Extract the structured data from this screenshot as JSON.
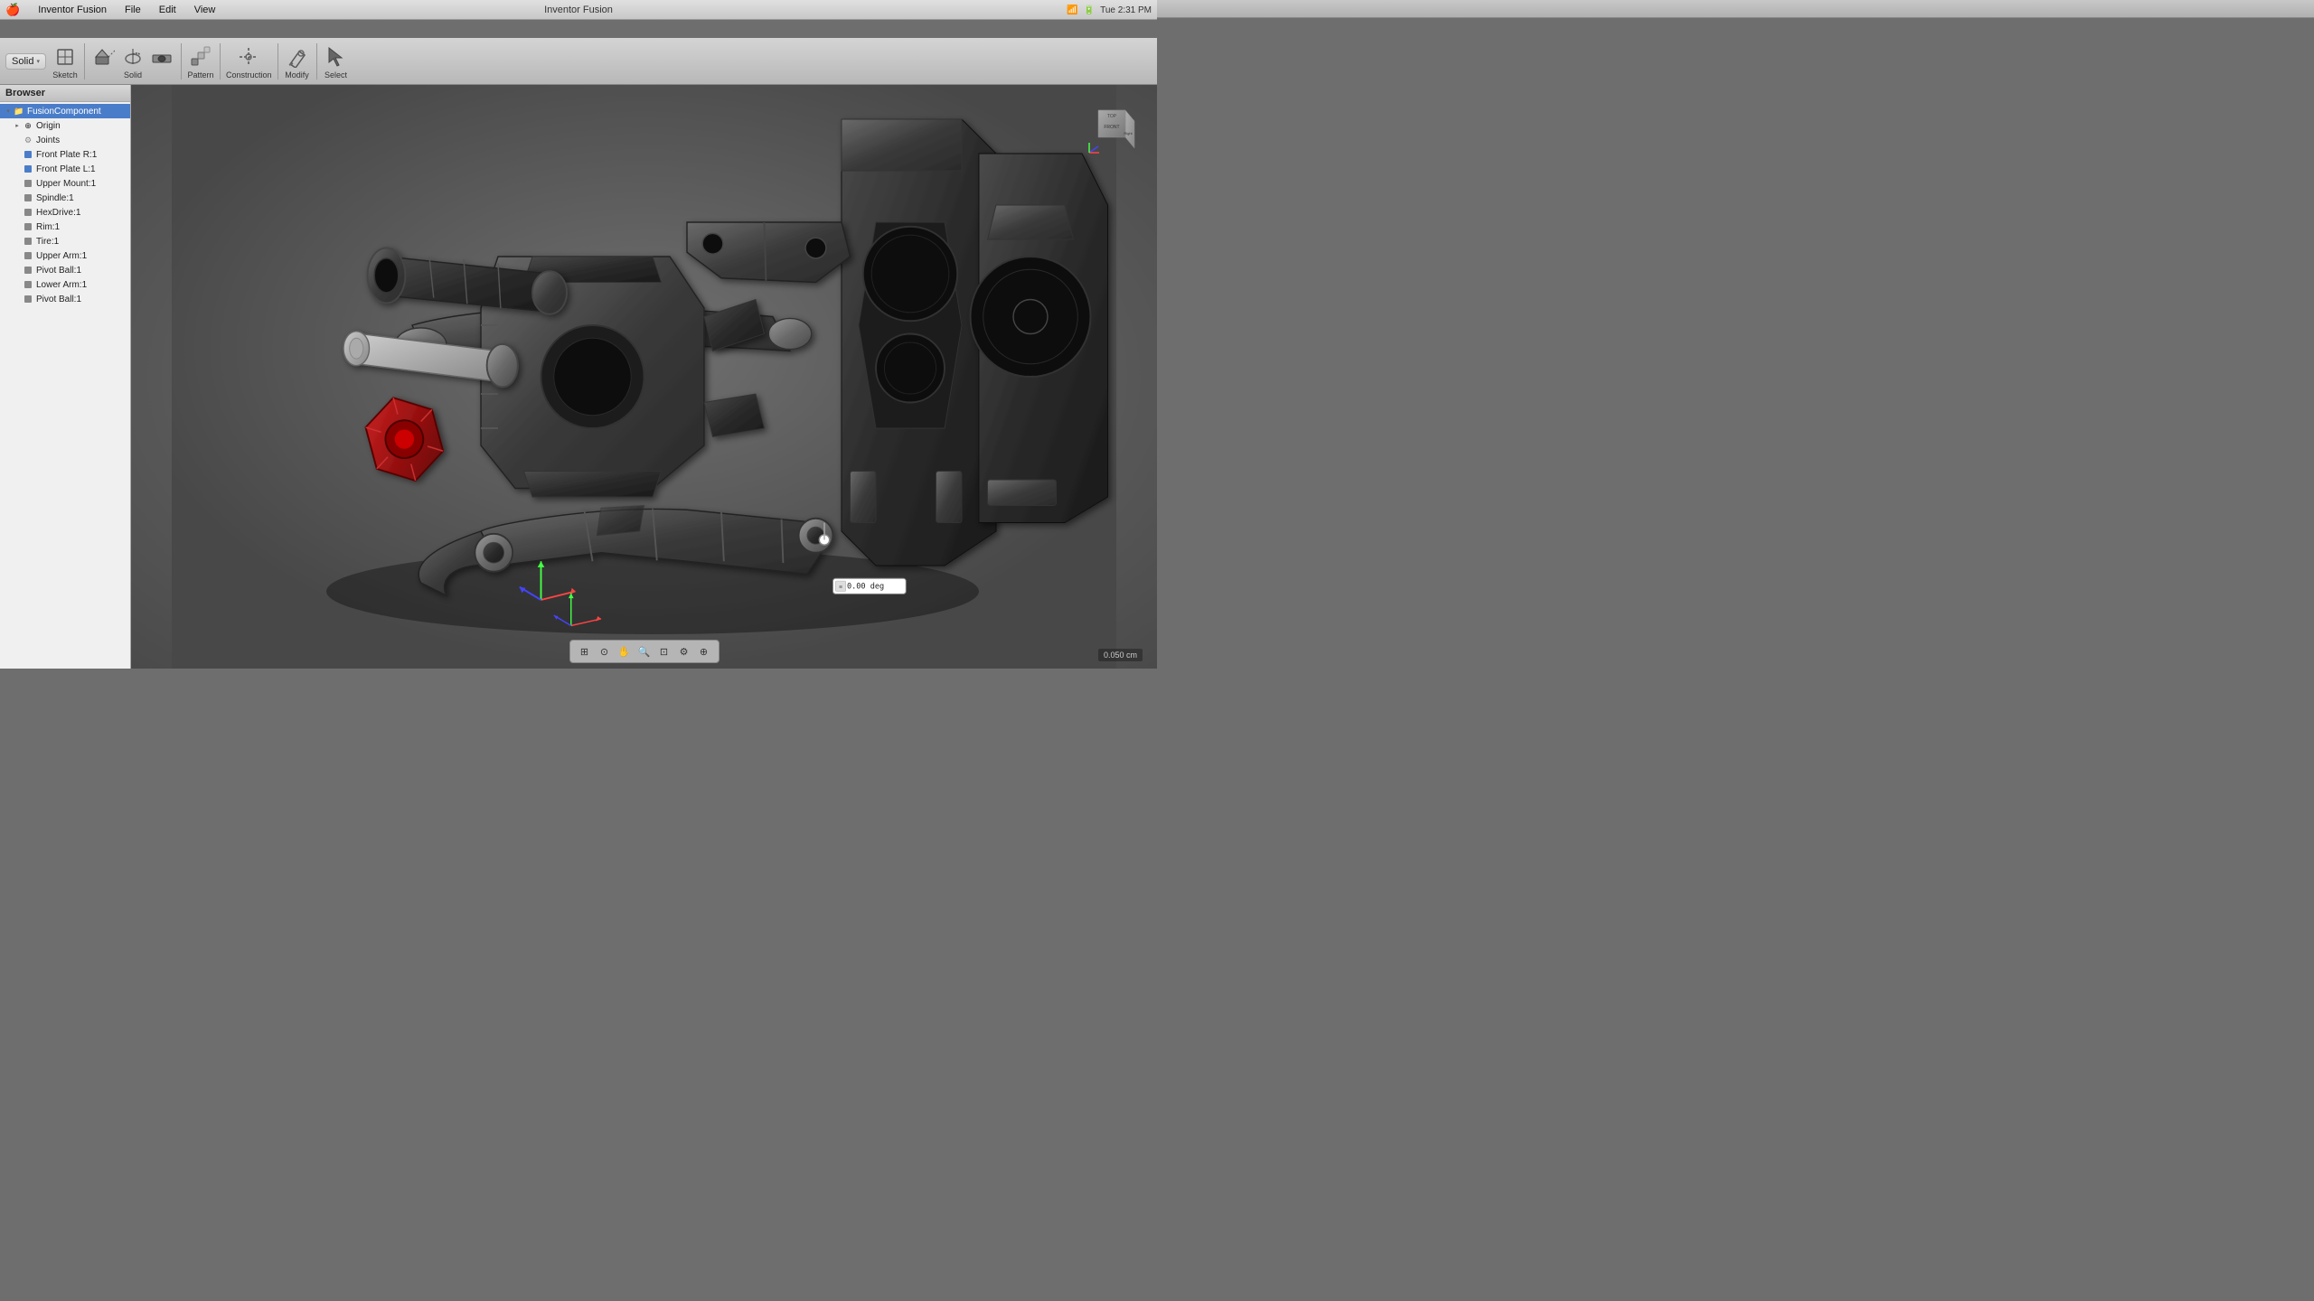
{
  "app": {
    "name": "Inventor Fusion",
    "title": "Inventor Fusion"
  },
  "menubar": {
    "apple": "🍎",
    "items": [
      "Inventor Fusion",
      "File",
      "Edit",
      "View"
    ],
    "time": "Tue 2:31 PM",
    "right_icons": [
      "wifi",
      "battery",
      "volume"
    ]
  },
  "mini_toolbar": {
    "items": [
      "←",
      "→",
      "⏹",
      "▶",
      "↺",
      "↻",
      "⊞"
    ]
  },
  "toolbar": {
    "solid_label": "Solid",
    "solid_arrow": "▾",
    "sketch_label": "Sketch",
    "solid_section_label": "Solid",
    "pattern_label": "Pattern",
    "construction_label": "Construction",
    "modify_label": "Modify",
    "select_label": "Select"
  },
  "browser": {
    "title": "Browser",
    "items": [
      {
        "id": "root",
        "label": "FusionComponent",
        "indent": 1,
        "toggle": "▾",
        "icon": "folder",
        "selected": true
      },
      {
        "id": "origin",
        "label": "Origin",
        "indent": 2,
        "toggle": "▸",
        "icon": "folder"
      },
      {
        "id": "joints",
        "label": "Joints",
        "indent": 2,
        "toggle": " ",
        "icon": "joint"
      },
      {
        "id": "frontplateR",
        "label": "Front Plate R:1",
        "indent": 2,
        "toggle": " ",
        "icon": "body"
      },
      {
        "id": "frontplateL",
        "label": "Front Plate L:1",
        "indent": 2,
        "toggle": " ",
        "icon": "body"
      },
      {
        "id": "uppermount",
        "label": "Upper Mount:1",
        "indent": 2,
        "toggle": " ",
        "icon": "body"
      },
      {
        "id": "spindle",
        "label": "Spindle:1",
        "indent": 2,
        "toggle": " ",
        "icon": "body"
      },
      {
        "id": "hexdrive",
        "label": "HexDrive:1",
        "indent": 2,
        "toggle": " ",
        "icon": "body"
      },
      {
        "id": "rim",
        "label": "Rim:1",
        "indent": 2,
        "toggle": " ",
        "icon": "body"
      },
      {
        "id": "tire",
        "label": "Tire:1",
        "indent": 2,
        "toggle": " ",
        "icon": "body"
      },
      {
        "id": "upperarm",
        "label": "Upper Arm:1",
        "indent": 2,
        "toggle": " ",
        "icon": "body"
      },
      {
        "id": "pivotball1",
        "label": "Pivot Ball:1",
        "indent": 2,
        "toggle": " ",
        "icon": "body"
      },
      {
        "id": "lowerarm",
        "label": "Lower Arm:1",
        "indent": 2,
        "toggle": " ",
        "icon": "body"
      },
      {
        "id": "pivotball2",
        "label": "Pivot Ball:1",
        "indent": 2,
        "toggle": " ",
        "icon": "body"
      }
    ]
  },
  "viewport": {
    "measurement_value": "0.00 deg",
    "scale_value": "0.050 cm"
  },
  "view_cube": {
    "face": "Right ,"
  },
  "bottom_toolbar": {
    "buttons": [
      "⊞",
      "⊙",
      "⧖",
      "⊡",
      "🔍",
      "⊕",
      "🔭"
    ]
  }
}
